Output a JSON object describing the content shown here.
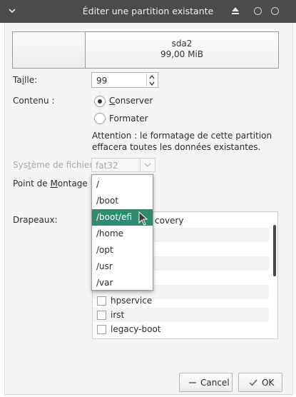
{
  "window": {
    "title": "Éditer une partition existante"
  },
  "partition": {
    "name": "sda2",
    "size": "99,00 MiB"
  },
  "size_field": {
    "label_pre": "Ta",
    "label_key": "i",
    "label_post": "lle:",
    "value": "99"
  },
  "content": {
    "label": "Contenu :",
    "keep_pre": "",
    "keep_key": "C",
    "keep_post": "onserver",
    "format_label": "Formater",
    "selected": "keep",
    "warning": "Attention : le formatage de cette partition effacera toutes les données existantes."
  },
  "filesystem": {
    "label_pre": "Sys",
    "label_key": "t",
    "label_post": "ème de fichiers:",
    "value": "fat32"
  },
  "mount": {
    "label_pre": "Point de ",
    "label_key": "M",
    "label_post": "ontage :",
    "options": [
      "/",
      "/boot",
      "/boot/efi",
      "/home",
      "/opt",
      "/usr",
      "/var"
    ],
    "highlighted": "/boot/efi"
  },
  "flags": {
    "label": "Drapeaux:",
    "items": [
      "covery",
      "hpservice",
      "irst",
      "legacy-boot"
    ]
  },
  "buttons": {
    "cancel": "Cancel",
    "ok": "OK"
  },
  "colors": {
    "titlebar": "#4b4b4b",
    "selection": "#2e8b70"
  }
}
